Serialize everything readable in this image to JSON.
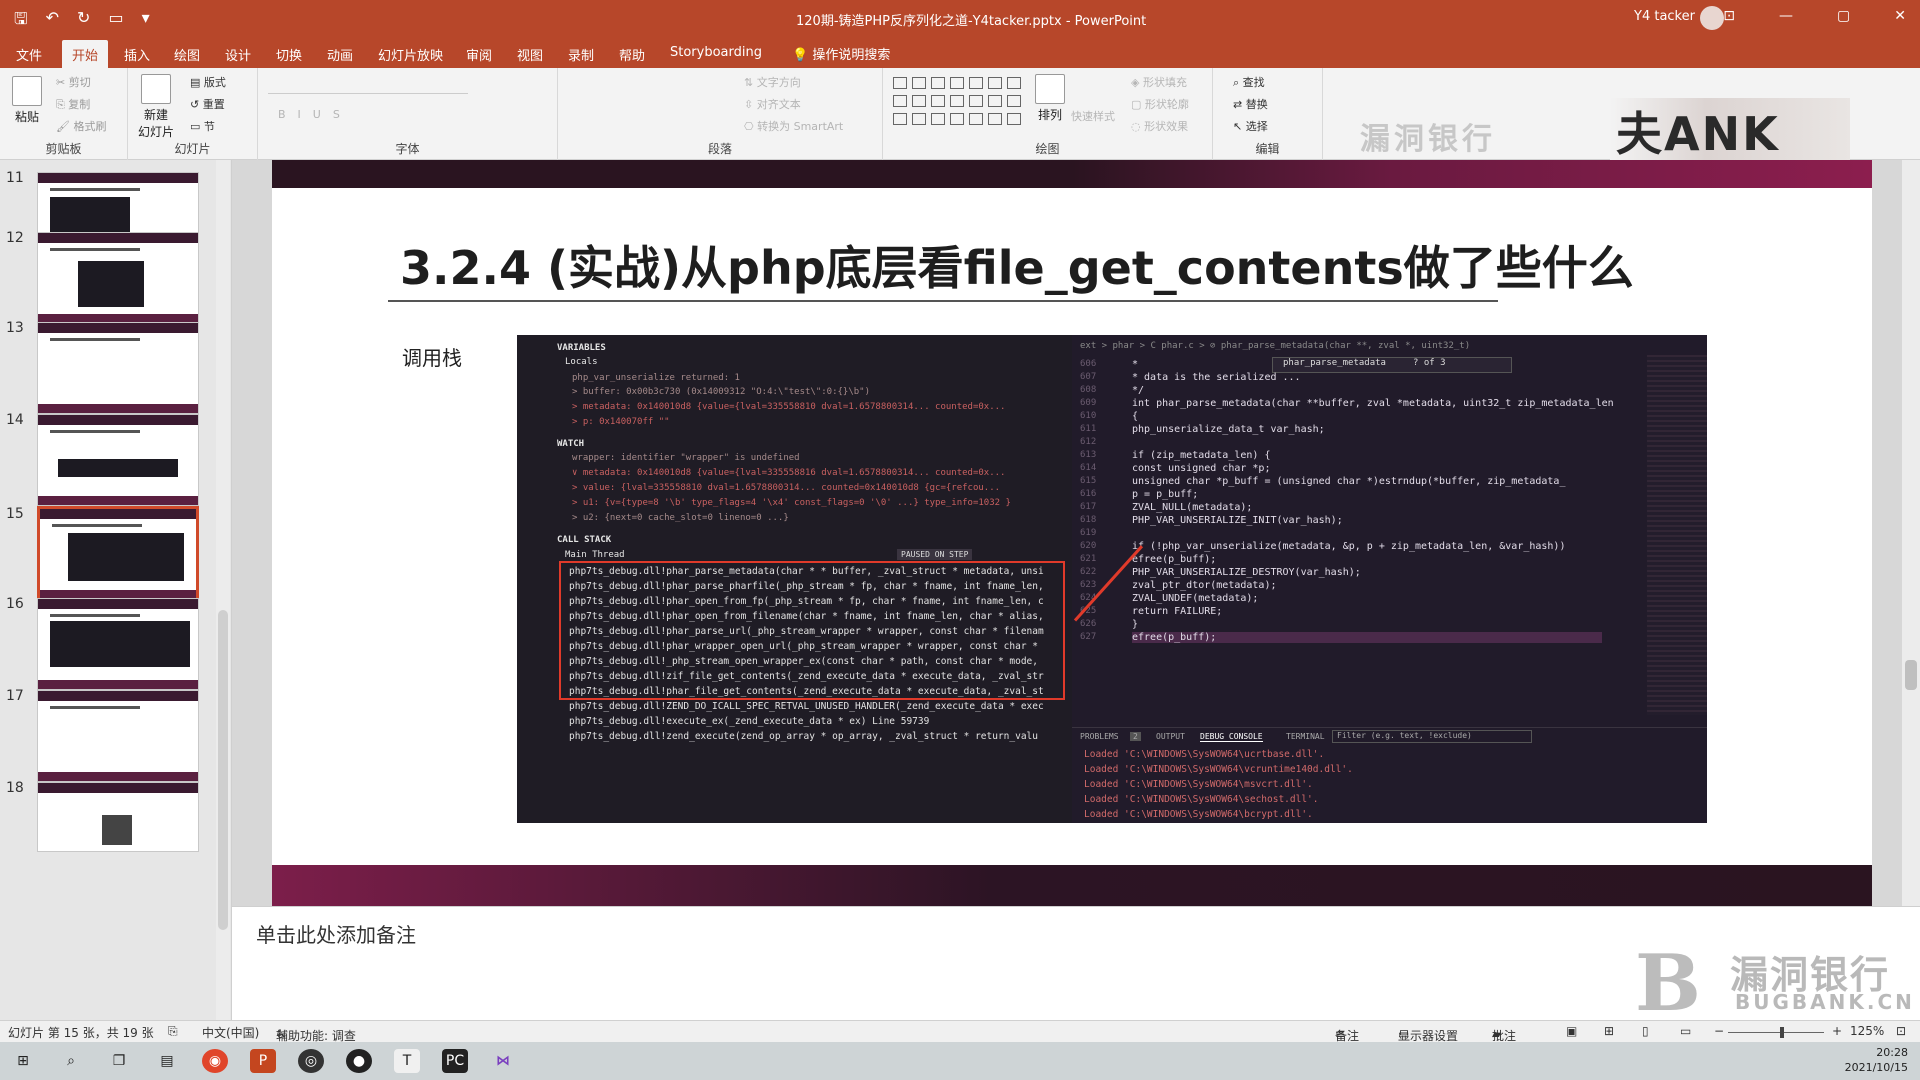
{
  "window": {
    "title": "120期-铸造PHP反序列化之道-Y4tacker.pptx  -  PowerPoint",
    "user": "Y4 tacker"
  },
  "menu": {
    "tabs": [
      "文件",
      "开始",
      "插入",
      "绘图",
      "设计",
      "切换",
      "动画",
      "幻灯片放映",
      "审阅",
      "视图",
      "录制",
      "帮助",
      "Storyboarding"
    ],
    "active": "开始",
    "tell_me": "操作说明搜索"
  },
  "ribbon": {
    "clipboard": {
      "label": "剪贴板",
      "paste": "粘贴",
      "cut": "剪切",
      "copy": "复制",
      "format_painter": "格式刷"
    },
    "slides": {
      "label": "幻灯片",
      "new_slide": "新建\n幻灯片",
      "layout": "版式",
      "reset": "重置",
      "section": "节"
    },
    "font": {
      "label": "字体"
    },
    "paragraph": {
      "label": "段落",
      "text_direction": "文字方向",
      "align_text": "对齐文本",
      "smartart": "转换为 SmartArt"
    },
    "drawing": {
      "label": "绘图",
      "arrange": "排列",
      "quick_styles": "快速样式",
      "fill": "形状填充",
      "outline": "形状轮廓",
      "effects": "形状效果"
    },
    "editing": {
      "label": "编辑",
      "find": "查找",
      "replace": "替换",
      "select": "选择"
    }
  },
  "thumbnails": [
    {
      "num": "11"
    },
    {
      "num": "12"
    },
    {
      "num": "13"
    },
    {
      "num": "14"
    },
    {
      "num": "15"
    },
    {
      "num": "16"
    },
    {
      "num": "17"
    },
    {
      "num": "18"
    }
  ],
  "slide": {
    "title": "3.2.4 (实战)从php底层看file_get_contents做了些什么",
    "label": "调用栈"
  },
  "debugger": {
    "variables_header": "VARIABLES",
    "locals_header": "Locals",
    "locals": [
      "php_var_unserialize returned: 1",
      "> buffer: 0x00b3c730 (0x14009312 \"O:4:\\\"test\\\":0:{}\\b\")",
      "> metadata: 0x140010d8 {value={lval=335558810 dval=1.6578800314... counted=0x...",
      "> p: 0x140070ff \"\""
    ],
    "watch_header": "WATCH",
    "watch": [
      "wrapper: identifier \"wrapper\" is undefined",
      "∨ metadata: 0x140010d8 {value={lval=335558816 dval=1.6578800314... counted=0x...",
      "> value: {lval=335558810 dval=1.6578800314... counted=0x140010d8 {gc={refcou...",
      "> u1: {v={type=8 '\\b' type_flags=4 '\\x4' const_flags=0 '\\0' ...} type_info=1032 }",
      "> u2: {next=0 cache_slot=0 lineno=0 ...}"
    ],
    "call_stack_header": "CALL STACK",
    "main_thread": "Main Thread",
    "paused": "PAUSED ON STEP",
    "stack": [
      "php7ts_debug.dll!phar_parse_metadata(char * * buffer, _zval_struct * metadata, unsi",
      "php7ts_debug.dll!phar_parse_pharfile(_php_stream * fp, char * fname, int fname_len,",
      "php7ts_debug.dll!phar_open_from_fp(_php_stream * fp, char * fname, int fname_len, c",
      "php7ts_debug.dll!phar_open_from_filename(char * fname, int fname_len, char * alias,",
      "php7ts_debug.dll!phar_parse_url(_php_stream_wrapper * wrapper, const char * filenam",
      "php7ts_debug.dll!phar_wrapper_open_url(_php_stream_wrapper * wrapper, const char *",
      "php7ts_debug.dll!_php_stream_open_wrapper_ex(const char * path, const char * mode,",
      "php7ts_debug.dll!zif_file_get_contents(_zend_execute_data * execute_data, _zval_str",
      "php7ts_debug.dll!phar_file_get_contents(_zend_execute_data * execute_data, _zval_st",
      "php7ts_debug.dll!ZEND_DO_ICALL_SPEC_RETVAL_UNUSED_HANDLER(_zend_execute_data * exec",
      "php7ts_debug.dll!execute_ex(_zend_execute_data * ex) Line 59739",
      "php7ts_debug.dll!zend_execute(zend_op_array * op_array, _zval_struct * return_valu"
    ],
    "breadcrumb": "ext > phar > C phar.c > ⊘ phar_parse_metadata(char **, zval *, uint32_t)",
    "find_text": "phar_parse_metadata",
    "find_count": "? of 3",
    "code_lines": [
      {
        "n": "606",
        "t": " *"
      },
      {
        "n": "607",
        "t": " * data is the serialized ..."
      },
      {
        "n": "608",
        "t": " */"
      },
      {
        "n": "609",
        "t": "int phar_parse_metadata(char **buffer, zval *metadata, uint32_t zip_metadata_len"
      },
      {
        "n": "610",
        "t": "{"
      },
      {
        "n": "611",
        "t": "    php_unserialize_data_t var_hash;"
      },
      {
        "n": "612",
        "t": ""
      },
      {
        "n": "613",
        "t": "    if (zip_metadata_len) {"
      },
      {
        "n": "614",
        "t": "        const unsigned char *p;"
      },
      {
        "n": "615",
        "t": "        unsigned char *p_buff = (unsigned char *)estrndup(*buffer, zip_metadata_"
      },
      {
        "n": "616",
        "t": "        p = p_buff;"
      },
      {
        "n": "617",
        "t": "        ZVAL_NULL(metadata);"
      },
      {
        "n": "618",
        "t": "        PHP_VAR_UNSERIALIZE_INIT(var_hash);"
      },
      {
        "n": "619",
        "t": ""
      },
      {
        "n": "620",
        "t": "        if (!php_var_unserialize(metadata, &p, p + zip_metadata_len, &var_hash))"
      },
      {
        "n": "621",
        "t": "            efree(p_buff);"
      },
      {
        "n": "622",
        "t": "            PHP_VAR_UNSERIALIZE_DESTROY(var_hash);"
      },
      {
        "n": "623",
        "t": "            zval_ptr_dtor(metadata);"
      },
      {
        "n": "624",
        "t": "            ZVAL_UNDEF(metadata);"
      },
      {
        "n": "625",
        "t": "            return FAILURE;"
      },
      {
        "n": "626",
        "t": "        }"
      },
      {
        "n": "627",
        "t": "        efree(p_buff);"
      }
    ],
    "panel_tabs": [
      "PROBLEMS",
      "2",
      "OUTPUT",
      "DEBUG CONSOLE",
      "TERMINAL"
    ],
    "filter_placeholder": "Filter (e.g. text, !exclude)",
    "console": [
      "Loaded 'C:\\WINDOWS\\SysWOW64\\ucrtbase.dll'.",
      "Loaded 'C:\\WINDOWS\\SysWOW64\\vcruntime140d.dll'.",
      "Loaded 'C:\\WINDOWS\\SysWOW64\\msvcrt.dll'.",
      "Loaded 'C:\\WINDOWS\\SysWOW64\\sechost.dll'.",
      "Loaded 'C:\\WINDOWS\\SysWOW64\\bcrypt.dll'."
    ]
  },
  "notes": {
    "placeholder": "单击此处添加备注"
  },
  "watermark": {
    "cn": "漏洞银行",
    "en": "BUGBANK.CN",
    "top": "漏洞银行"
  },
  "status": {
    "slide_info": "幻灯片 第 15 张，共 19 张",
    "language": "中文(中国)",
    "accessibility": "辅助功能: 调查",
    "notes_btn": "备注",
    "display_settings": "显示器设置",
    "comments": "批注",
    "zoom": "125%"
  },
  "taskbar": {
    "time": "20:28",
    "date": "2021/10/15"
  }
}
